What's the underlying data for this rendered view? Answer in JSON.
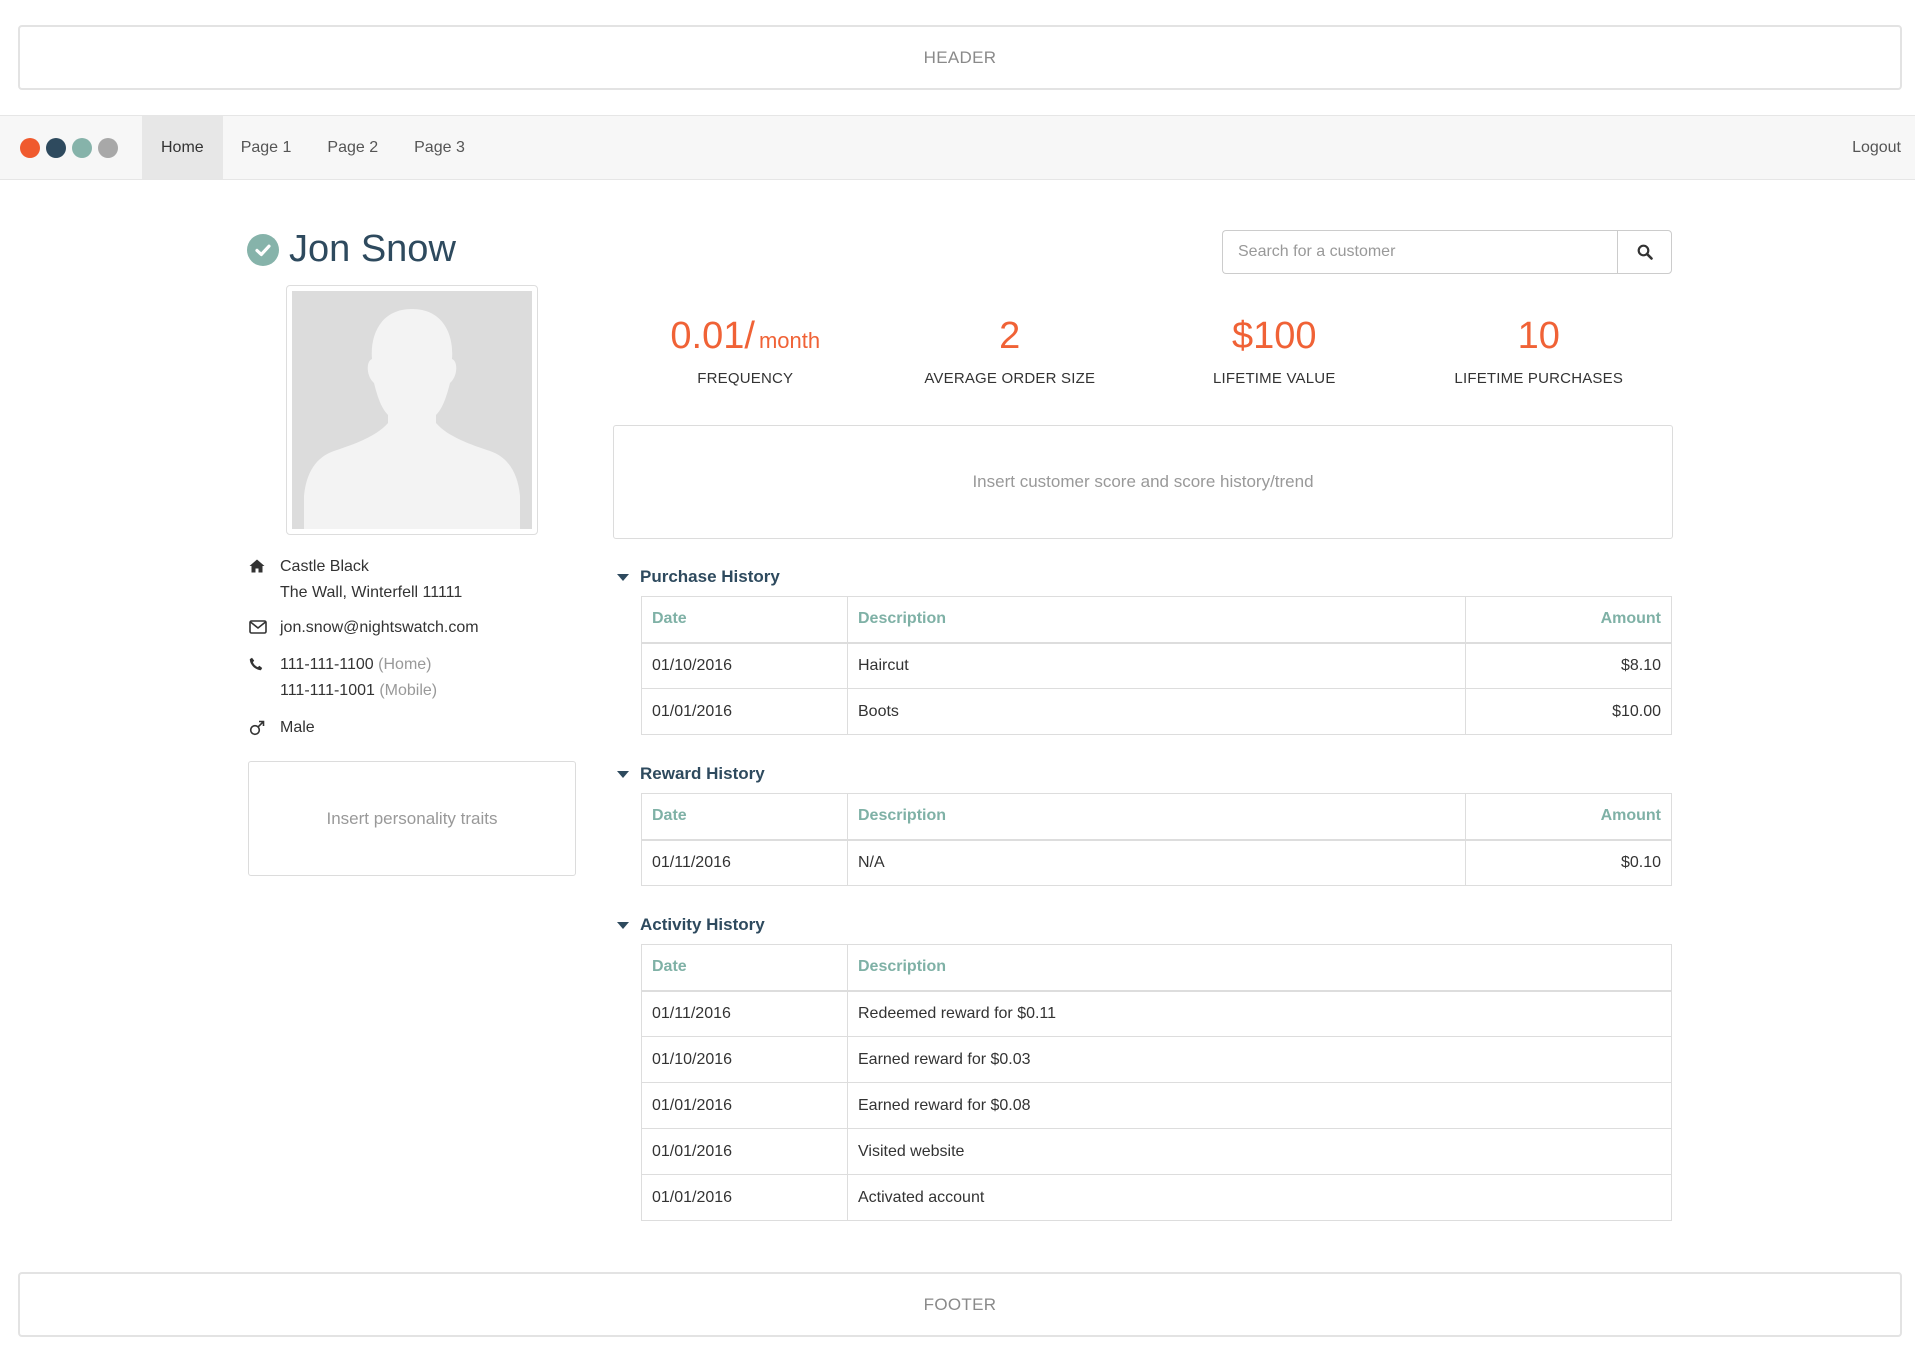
{
  "header": {
    "label": "HEADER"
  },
  "footer": {
    "label": "FOOTER"
  },
  "nav": {
    "brand_colors": [
      "#f05a2e",
      "#2e4a5e",
      "#86b3aa",
      "#a8a8a8"
    ],
    "items": [
      {
        "label": "Home",
        "active": true
      },
      {
        "label": "Page 1"
      },
      {
        "label": "Page 2"
      },
      {
        "label": "Page 3"
      }
    ],
    "logout": "Logout"
  },
  "profile": {
    "name": "Jon Snow",
    "verified_icon": "check-circle-icon",
    "address_line1": "Castle Black",
    "address_line2": "The Wall, Winterfell 11111",
    "email": "jon.snow@nightswatch.com",
    "phone_home": "111-111-1100",
    "phone_home_label": "(Home)",
    "phone_mobile": "111-111-1001",
    "phone_mobile_label": "(Mobile)",
    "gender": "Male",
    "traits_placeholder": "Insert personality traits"
  },
  "search": {
    "placeholder": "Search for a customer"
  },
  "stats": [
    {
      "value": "0.01/",
      "unit": "month",
      "label": "FREQUENCY"
    },
    {
      "value": "2",
      "label": "AVERAGE ORDER SIZE"
    },
    {
      "value": "$100",
      "label": "LIFETIME VALUE"
    },
    {
      "value": "10",
      "label": "LIFETIME PURCHASES"
    }
  ],
  "score_placeholder": "Insert customer score and score history/trend",
  "purchase_history": {
    "title": "Purchase History",
    "columns": [
      "Date",
      "Description",
      "Amount"
    ],
    "rows": [
      {
        "date": "01/10/2016",
        "description": "Haircut",
        "amount": "$8.10"
      },
      {
        "date": "01/01/2016",
        "description": "Boots",
        "amount": "$10.00"
      }
    ]
  },
  "reward_history": {
    "title": "Reward History",
    "columns": [
      "Date",
      "Description",
      "Amount"
    ],
    "rows": [
      {
        "date": "01/11/2016",
        "description": "N/A",
        "amount": "$0.10"
      }
    ]
  },
  "activity_history": {
    "title": "Activity History",
    "columns": [
      "Date",
      "Description"
    ],
    "rows": [
      {
        "date": "01/11/2016",
        "description": "Redeemed reward for $0.11"
      },
      {
        "date": "01/10/2016",
        "description": "Earned reward for $0.03"
      },
      {
        "date": "01/01/2016",
        "description": "Earned reward for $0.08"
      },
      {
        "date": "01/01/2016",
        "description": "Visited website"
      },
      {
        "date": "01/01/2016",
        "description": "Activated account"
      }
    ]
  },
  "colors": {
    "accent": "#f06236",
    "title": "#2e4a5e",
    "teal": "#86b3aa"
  }
}
